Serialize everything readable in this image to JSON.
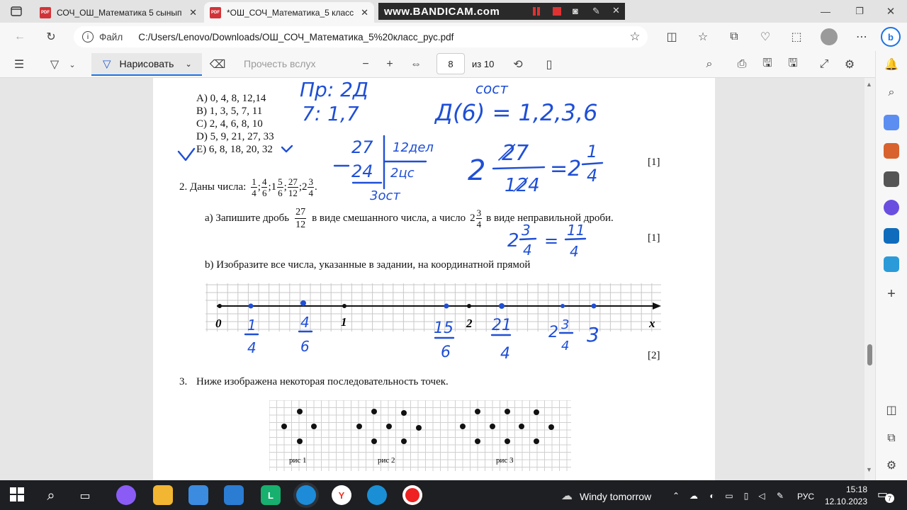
{
  "browser": {
    "tabs": [
      {
        "title": "СОЧ_ОШ_Математика 5 сынып",
        "active": false
      },
      {
        "title": "*ОШ_СОЧ_Математика_5 класс",
        "active": true
      }
    ],
    "watermark": "www.BANDICAM.com",
    "address_label": "Файл",
    "url": "C:/Users/Lenovo/Downloads/ОШ_СОЧ_Математика_5%20класс_рус.pdf"
  },
  "pdf_toolbar": {
    "draw_label": "Нарисовать",
    "read_aloud_label": "Прочесть вслух",
    "page_number": "8",
    "page_total": "из 10"
  },
  "document": {
    "options": [
      "A) 0, 4, 8, 12,14",
      "B) 1, 3, 5, 7, 11",
      "C) 2, 4, 6, 8, 10",
      "D) 5, 9, 21, 27, 33",
      "E) 6, 8, 18, 20, 32"
    ],
    "mark1": "[1]",
    "q2_prefix": "2. Даны числа:",
    "q2_numbers": [
      {
        "whole": "",
        "num": "1",
        "den": "4"
      },
      {
        "whole": "",
        "num": "4",
        "den": "6"
      },
      {
        "whole": "1",
        "num": "5",
        "den": "6"
      },
      {
        "whole": "",
        "num": "27",
        "den": "12"
      },
      {
        "whole": "2",
        "num": "3",
        "den": "4"
      }
    ],
    "q2a_text1": "а) Запишите дробь",
    "q2a_frac_num": "27",
    "q2a_frac_den": "12",
    "q2a_text2": "в виде смешанного числа, а число",
    "q2a_mixed_whole": "2",
    "q2a_mixed_num": "3",
    "q2a_mixed_den": "4",
    "q2a_text3": "в виде неправильной дроби.",
    "mark2": "[1]",
    "q2b_text": "b) Изобразите все числа, указанные в задании, на координатной прямой",
    "axis_labels": {
      "zero": "0",
      "one": "1",
      "two": "2",
      "x": "x"
    },
    "mark3": "[2]",
    "q3_number": "3.",
    "q3_text": "Ниже изображена некоторая последовательность точек.",
    "fig_labels": [
      "рис 1",
      "рис 2",
      "рис 3"
    ]
  },
  "handwriting": {
    "line1": "Пр: 2Д",
    "line2": "7: 1,7",
    "line3": "сост",
    "line4": "Д(6) = 1,2,3,6",
    "division": [
      "27",
      "12дел",
      "24",
      "2цс",
      "3ост"
    ],
    "mixed_result": "2 27/12 = 2 1/4",
    "improper": "2 3/4 = 11/4",
    "axis_marks": [
      "1/4",
      "4/6",
      "15/6",
      "21/4",
      "2 3/4",
      "3"
    ]
  },
  "taskbar": {
    "weather": "Windy tomorrow",
    "lang": "РУС",
    "time": "15:18",
    "date": "12.10.2023",
    "notifications": "7"
  }
}
